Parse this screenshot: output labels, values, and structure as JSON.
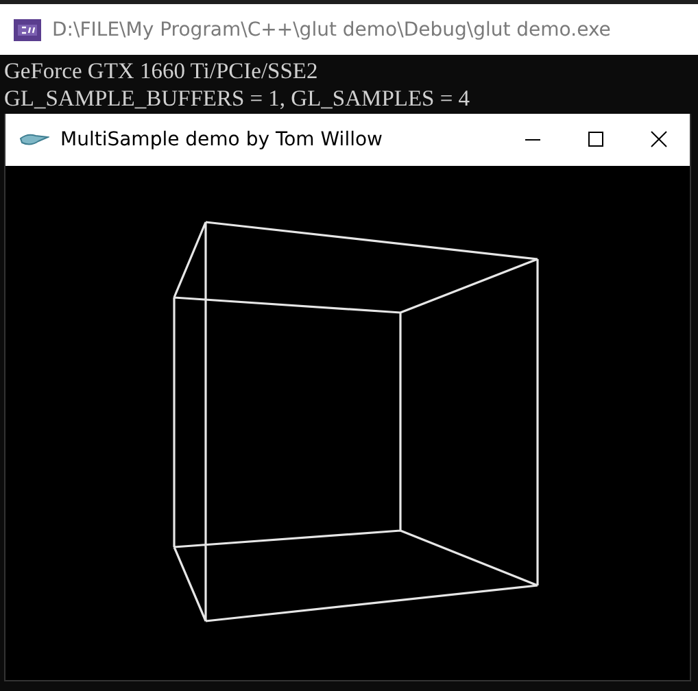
{
  "console_window": {
    "title": "D:\\FILE\\My Program\\C++\\glut demo\\Debug\\glut demo.exe",
    "lines": [
      "GeForce GTX 1660 Ti/PCIe/SSE2",
      "GL_SAMPLE_BUFFERS = 1, GL_SAMPLES = 4"
    ]
  },
  "glut_window": {
    "title": "MultiSample demo by Tom Willow"
  }
}
